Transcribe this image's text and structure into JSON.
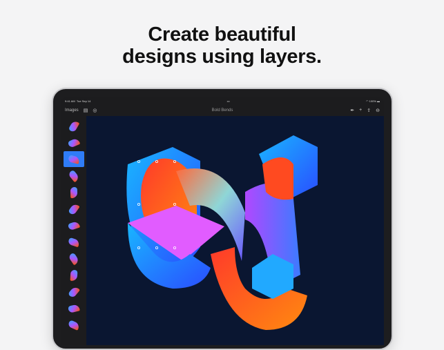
{
  "headline": {
    "line1": "Create beautiful",
    "line2": "designs using layers."
  },
  "status": {
    "time": "9:41 AM",
    "date": "Tue Sep 14",
    "battery": "100%"
  },
  "toolbar": {
    "images_label": "Images",
    "title": "Bold Bends"
  },
  "layers": {
    "count": 13,
    "selected_index": 2
  },
  "colors": {
    "canvas": "#0a1631",
    "accent": "#2f7cf6"
  }
}
